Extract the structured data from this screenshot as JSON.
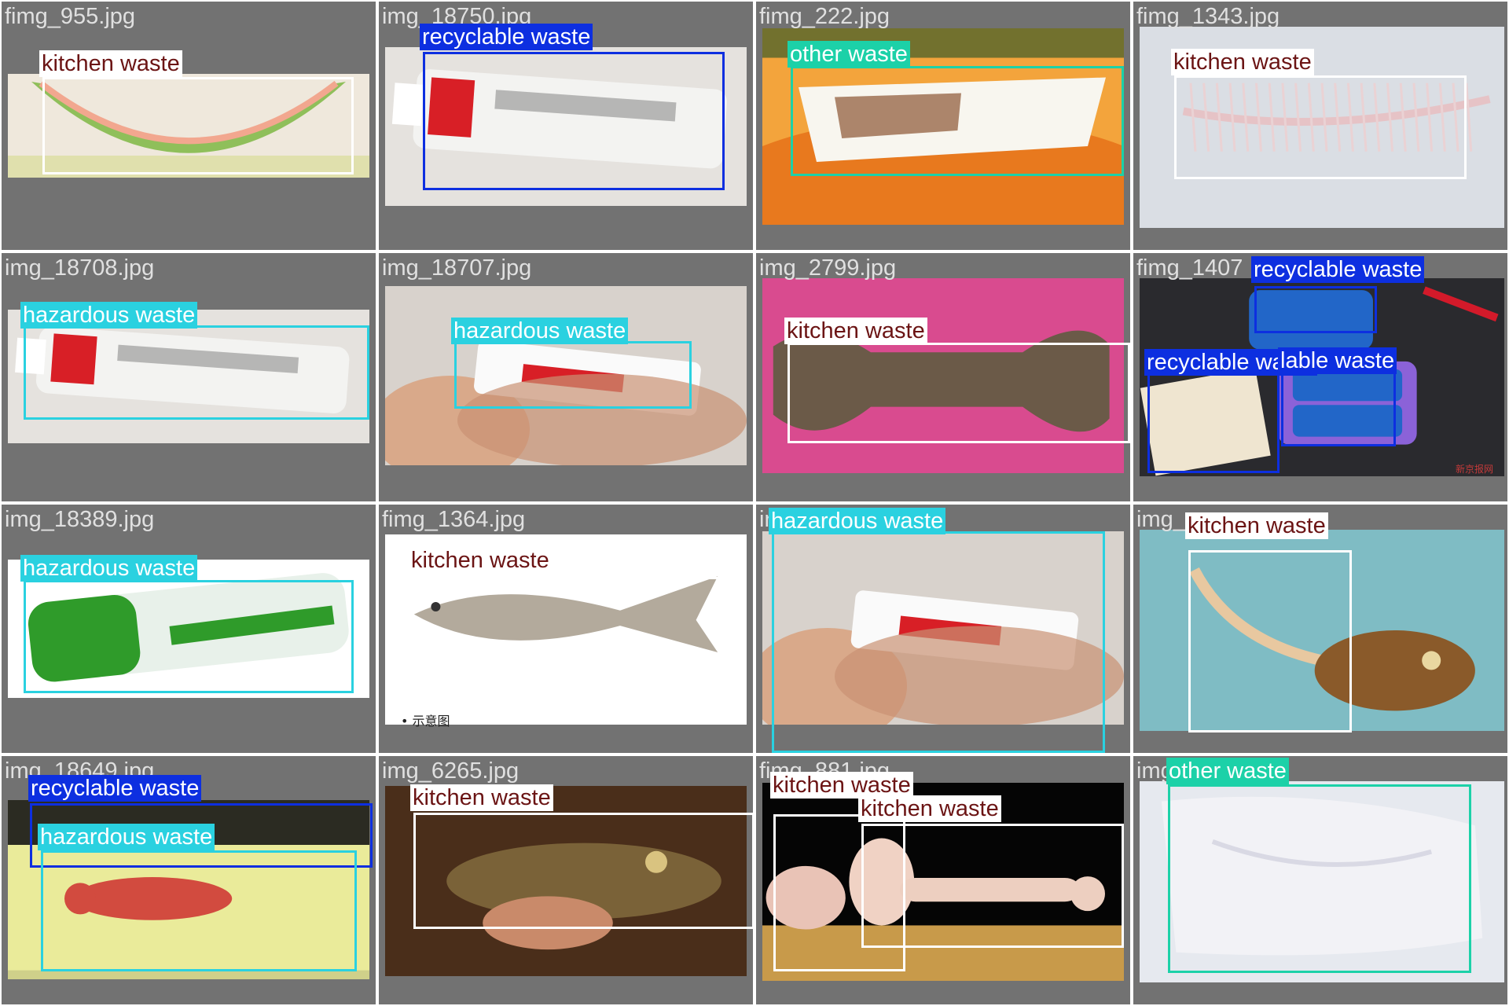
{
  "colors": {
    "kitchen": "#ffffff",
    "kitchen_text": "#6b1414",
    "recyclable": "#0d2fe0",
    "hazardous": "#2ad1e0",
    "other": "#1cd1a8",
    "light_text": "#ffffff",
    "dark_text": "#ffffff",
    "tile_bg": "#727272"
  },
  "tiles": [
    {
      "filename": "fimg_955.jpg",
      "image_desc": "watermelon-rind",
      "detections": [
        {
          "label": "kitchen waste",
          "class": "kitchen"
        }
      ]
    },
    {
      "filename": "img_18750.jpg",
      "image_desc": "ointment-tube",
      "detections": [
        {
          "label": "recyclable waste",
          "class": "recyclable"
        }
      ]
    },
    {
      "filename": "fimg_222.jpg",
      "image_desc": "foam-takeout-box",
      "detections": [
        {
          "label": "other waste",
          "class": "other"
        }
      ]
    },
    {
      "filename": "fimg_1343.jpg",
      "image_desc": "fish-skeleton",
      "detections": [
        {
          "label": "kitchen waste",
          "class": "kitchen"
        }
      ]
    },
    {
      "filename": "img_18708.jpg",
      "image_desc": "ointment-tube",
      "detections": [
        {
          "label": "hazardous waste",
          "class": "hazardous"
        }
      ]
    },
    {
      "filename": "img_18707.jpg",
      "image_desc": "ointment-in-hand",
      "detections": [
        {
          "label": "hazardous waste",
          "class": "hazardous"
        }
      ]
    },
    {
      "filename": "img_2799.jpg",
      "image_desc": "bone-on-pink",
      "detections": [
        {
          "label": "kitchen waste",
          "class": "kitchen"
        }
      ]
    },
    {
      "filename": "fimg_1407",
      "image_desc": "batteries",
      "detections": [
        {
          "label": "recyclable waste",
          "class": "recyclable"
        },
        {
          "label": "recyclable waste",
          "class": "recyclable"
        },
        {
          "label": "lable waste",
          "class": "recyclable"
        }
      ]
    },
    {
      "filename": "img_18389.jpg",
      "image_desc": "aa-battery",
      "detections": [
        {
          "label": "hazardous waste",
          "class": "hazardous"
        }
      ]
    },
    {
      "filename": "fimg_1364.jpg",
      "image_desc": "fish-remains",
      "detections": [
        {
          "label": "kitchen waste",
          "class": "kitchen"
        }
      ]
    },
    {
      "filename": "ir",
      "image_desc": "ointment-in-hand",
      "detections": [
        {
          "label": "hazardous waste",
          "class": "hazardous"
        }
      ]
    },
    {
      "filename": "img_",
      "image_desc": "fish-head",
      "detections": [
        {
          "label": "kitchen waste",
          "class": "kitchen"
        }
      ]
    },
    {
      "filename": "img_18649.jpg",
      "image_desc": "ointment-box",
      "detections": [
        {
          "label": "recyclable waste",
          "class": "recyclable"
        },
        {
          "label": "hazardous waste",
          "class": "hazardous"
        }
      ]
    },
    {
      "filename": "img_6265.jpg",
      "image_desc": "fish-in-hand",
      "detections": [
        {
          "label": "kitchen waste",
          "class": "kitchen"
        }
      ]
    },
    {
      "filename": "fimg_881.jpg",
      "image_desc": "meat-bones",
      "detections": [
        {
          "label": "kitchen waste",
          "class": "kitchen"
        },
        {
          "label": "kitchen waste",
          "class": "kitchen"
        }
      ]
    },
    {
      "filename": "img",
      "image_desc": "plastic-bag",
      "detections": [
        {
          "label": "other waste",
          "class": "other"
        }
      ]
    }
  ],
  "stamps": {
    "fimg_1364_caption": "• 示意图",
    "fimg_1407_mark": "新京报网"
  }
}
